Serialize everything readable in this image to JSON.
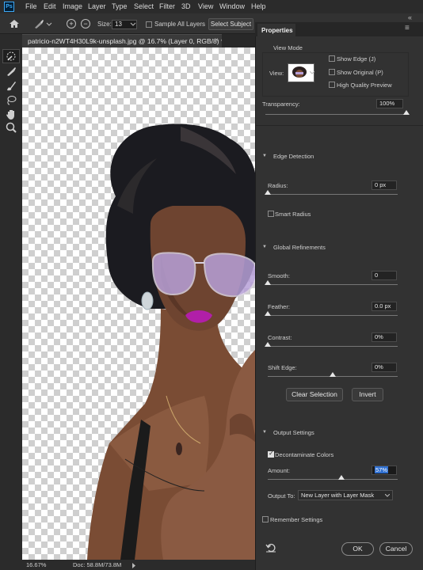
{
  "app": {
    "logo_text": "Ps"
  },
  "menu": [
    "File",
    "Edit",
    "Image",
    "Layer",
    "Type",
    "Select",
    "Filter",
    "3D",
    "View",
    "Window",
    "Help"
  ],
  "window_controls": {
    "minimize": "–",
    "maximize": "☐",
    "close": "✕"
  },
  "options_bar": {
    "size_label": "Size:",
    "size_value": "13",
    "sample_all_layers_label": "Sample All Layers",
    "select_subject_label": "Select Subject"
  },
  "document": {
    "tab_title": "patricio-n2WT4H30L9k-unsplash.jpg @ 16.7% (Layer 0, RGB/8) *",
    "close_glyph": "×"
  },
  "status": {
    "zoom": "16.67%",
    "doc_info": "Doc: 58.8M/73.8M"
  },
  "properties": {
    "title": "Properties",
    "view_mode": {
      "section": "View Mode",
      "view_label": "View:",
      "show_edge": "Show Edge (J)",
      "show_original": "Show Original (P)",
      "high_quality_preview": "High Quality Preview"
    },
    "transparency": {
      "label": "Transparency:",
      "value": "100%",
      "level": 1.0
    },
    "edge_detection": {
      "section": "Edge Detection",
      "radius_label": "Radius:",
      "radius_value": "0 px",
      "radius_level": 0.0,
      "smart_radius_label": "Smart Radius"
    },
    "global_refinements": {
      "section": "Global Refinements",
      "smooth_label": "Smooth:",
      "smooth_value": "0",
      "smooth_level": 0.0,
      "feather_label": "Feather:",
      "feather_value": "0.0 px",
      "feather_level": 0.0,
      "contrast_label": "Contrast:",
      "contrast_value": "0%",
      "contrast_level": 0.0,
      "shift_edge_label": "Shift Edge:",
      "shift_edge_value": "0%",
      "shift_edge_level": 0.5
    },
    "clear_selection_label": "Clear Selection",
    "invert_label": "Invert",
    "output_settings": {
      "section": "Output Settings",
      "decontaminate_label": "Decontaminate Colors",
      "decontaminate_checked": true,
      "amount_label": "Amount:",
      "amount_value": "57%",
      "amount_level": 0.57,
      "output_to_label": "Output To:",
      "output_to_value": "New Layer with Layer Mask"
    },
    "remember_settings_label": "Remember Settings",
    "ok_label": "OK",
    "cancel_label": "Cancel"
  },
  "colors": {
    "accent": "#3ea8f5",
    "panel_bg": "#323232",
    "app_bg": "#282828"
  }
}
